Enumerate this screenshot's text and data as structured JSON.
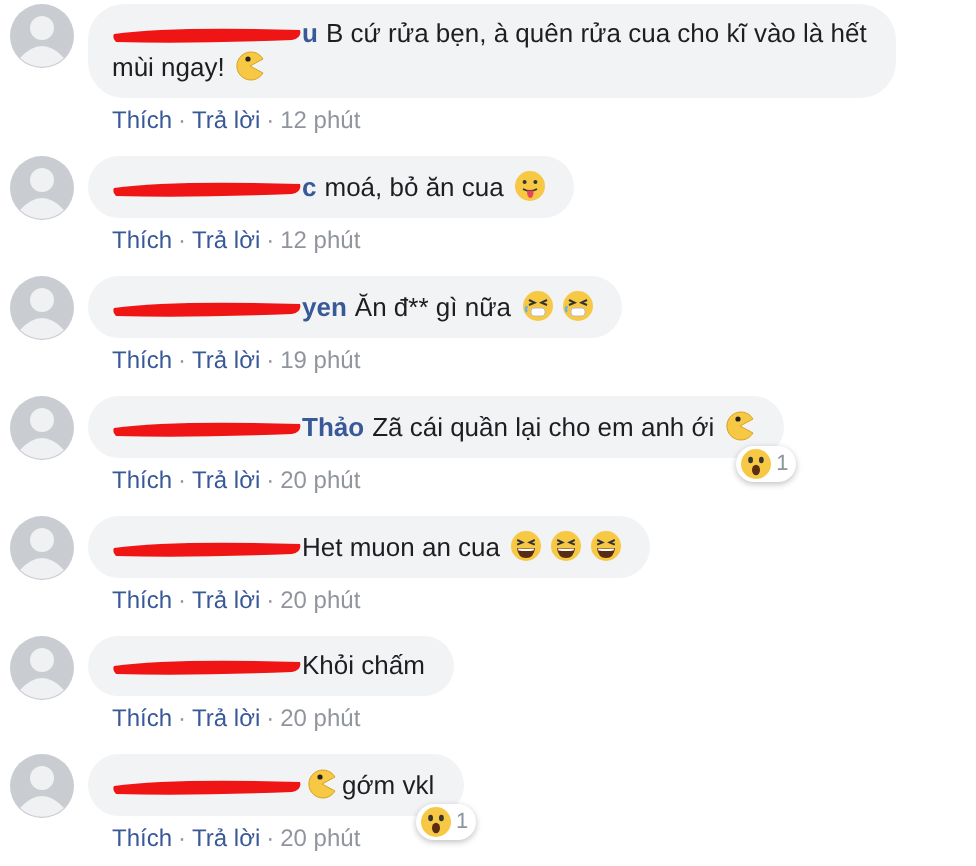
{
  "comments": [
    {
      "name_fragment": "u",
      "content": [
        {
          "kind": "text",
          "text": "B cứ rửa bẹn, à quên rửa cua cho kĩ vào là hết"
        },
        {
          "kind": "text",
          "text": "mùi ngay!"
        },
        {
          "kind": "pacman"
        }
      ],
      "actions": [
        {
          "kind": "link",
          "text": "Thích"
        },
        {
          "kind": "dot",
          "text": "·"
        },
        {
          "kind": "link",
          "text": "Trả lời"
        },
        {
          "kind": "dot",
          "text": "·"
        },
        {
          "kind": "time",
          "text": "12 phút"
        }
      ]
    },
    {
      "name_fragment": "c",
      "content": [
        {
          "kind": "text",
          "text": "moá, bỏ ăn cua"
        },
        {
          "kind": "tongue"
        }
      ],
      "actions": [
        {
          "kind": "link",
          "text": "Thích"
        },
        {
          "kind": "dot",
          "text": "·"
        },
        {
          "kind": "link",
          "text": "Trả lời"
        },
        {
          "kind": "dot",
          "text": "·"
        },
        {
          "kind": "time",
          "text": "12 phút"
        }
      ]
    },
    {
      "name_fragment": "yen",
      "content": [
        {
          "kind": "text",
          "text": "Ăn đ** gì nữa"
        },
        {
          "kind": "squint"
        },
        {
          "kind": "squint"
        }
      ],
      "actions": [
        {
          "kind": "link",
          "text": "Thích"
        },
        {
          "kind": "dot",
          "text": "·"
        },
        {
          "kind": "link",
          "text": "Trả lời"
        },
        {
          "kind": "dot",
          "text": "·"
        },
        {
          "kind": "time",
          "text": "19 phút"
        }
      ]
    },
    {
      "name_fragment": "Thảo",
      "content": [
        {
          "kind": "text",
          "text": "Zã cái quần lại cho em anh ới"
        },
        {
          "kind": "pacman"
        }
      ],
      "reaction": {
        "kind": "wow",
        "count": "1"
      },
      "actions": [
        {
          "kind": "link",
          "text": "Thích"
        },
        {
          "kind": "dot",
          "text": "·"
        },
        {
          "kind": "link",
          "text": "Trả lời"
        },
        {
          "kind": "dot",
          "text": "·"
        },
        {
          "kind": "time",
          "text": "20 phút"
        }
      ]
    },
    {
      "content": [
        {
          "kind": "text",
          "text": "Het muon an cua"
        },
        {
          "kind": "laugh"
        },
        {
          "kind": "laugh"
        },
        {
          "kind": "laugh"
        }
      ],
      "actions": [
        {
          "kind": "link",
          "text": "Thích"
        },
        {
          "kind": "dot",
          "text": "·"
        },
        {
          "kind": "link",
          "text": "Trả lời"
        },
        {
          "kind": "dot",
          "text": "·"
        },
        {
          "kind": "time",
          "text": "20 phút"
        }
      ]
    },
    {
      "content": [
        {
          "kind": "text",
          "text": "Khỏi chấm"
        }
      ],
      "actions": [
        {
          "kind": "link",
          "text": "Thích"
        },
        {
          "kind": "dot",
          "text": "·"
        },
        {
          "kind": "link",
          "text": "Trả lời"
        },
        {
          "kind": "dot",
          "text": "·"
        },
        {
          "kind": "time",
          "text": "20 phút"
        }
      ]
    },
    {
      "content": [
        {
          "kind": "pacman"
        },
        {
          "kind": "text",
          "text": "gớm vkl"
        }
      ],
      "reaction": {
        "kind": "wow",
        "count": "1"
      },
      "actions": [
        {
          "kind": "link",
          "text": "Thích"
        },
        {
          "kind": "dot",
          "text": "·"
        },
        {
          "kind": "link",
          "text": "Trả lời"
        },
        {
          "kind": "dot",
          "text": "·"
        },
        {
          "kind": "time",
          "text": "20 phút"
        }
      ]
    }
  ]
}
